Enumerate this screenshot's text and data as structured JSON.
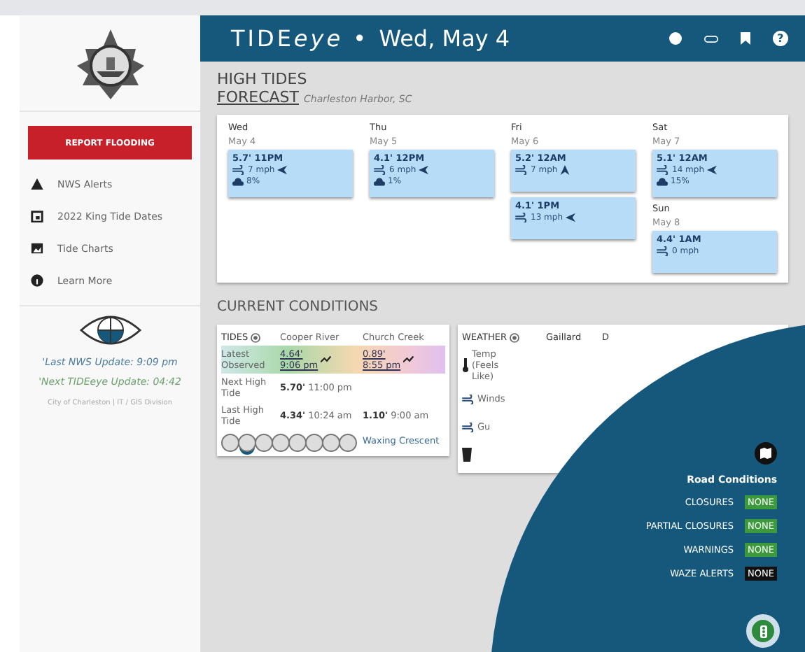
{
  "header": {
    "brand": "TIDE",
    "brand_em": "eye",
    "separator": "•",
    "date": "Wed, May 4",
    "help_icon": "?"
  },
  "sidebar": {
    "report_button": "REPORT FLOODING",
    "links": [
      {
        "label": "NWS Alerts",
        "kind": "alert"
      },
      {
        "label": "2022 King Tide Dates",
        "kind": "calendar"
      },
      {
        "label": "Tide Charts",
        "kind": "chart"
      },
      {
        "label": "Learn More",
        "kind": "info"
      }
    ],
    "last_update": "'Last NWS Update: 9:09 pm",
    "next_update": "'Next TIDEeye Update: 04:42",
    "credit": "City of Charleston | IT / GIS Division"
  },
  "forecast": {
    "title": "HIGH TIDES",
    "subtitle": "FORECAST",
    "location": "Charleston Harbor, SC",
    "columns": [
      {
        "days": [
          {
            "day": "Wed",
            "date": "May 4",
            "tides": [
              {
                "height": "5.7'",
                "time": "11PM",
                "wind": "7 mph",
                "kind": "left",
                "precip": "8%"
              }
            ]
          }
        ]
      },
      {
        "days": [
          {
            "day": "Thu",
            "date": "May 5",
            "tides": [
              {
                "height": "4.1'",
                "time": "12PM",
                "wind": "6 mph",
                "kind": "left",
                "precip": "1%"
              }
            ]
          }
        ]
      },
      {
        "days": [
          {
            "day": "Fri",
            "date": "May 6",
            "tides": [
              {
                "height": "5.2'",
                "time": "12AM",
                "wind": "7 mph",
                "kind": "up"
              },
              {
                "height": "4.1'",
                "time": "1PM",
                "wind": "13 mph",
                "kind": "left"
              }
            ]
          }
        ]
      },
      {
        "days": [
          {
            "day": "Sat",
            "date": "May 7",
            "tides": [
              {
                "height": "5.1'",
                "time": "12AM",
                "wind": "14 mph",
                "kind": "left",
                "precip": "15%"
              }
            ]
          },
          {
            "day": "Sun",
            "date": "May 8",
            "tides": [
              {
                "height": "4.4'",
                "time": "1AM",
                "wind": "0 mph",
                "kind": "calm"
              }
            ]
          }
        ]
      }
    ]
  },
  "conditions": {
    "title": "CURRENT CONDITIONS",
    "tides": {
      "heading": "TIDES",
      "columns": [
        "Cooper River",
        "Church Creek"
      ],
      "rows": [
        {
          "label": "Latest Observed",
          "kind": "observed",
          "cells": [
            {
              "height": "4.64'",
              "time": "9:06 pm"
            },
            {
              "height": "0.89'",
              "time": "8:55 pm"
            }
          ]
        },
        {
          "label": "Next High Tide",
          "kind": "plain",
          "cells": [
            {
              "height": "5.70'",
              "time": "11:00 pm"
            }
          ]
        },
        {
          "label": "Last High Tide",
          "kind": "plain",
          "cells": [
            {
              "height": "4.34'",
              "time": "10:24 am"
            },
            {
              "height": "1.10'",
              "time": "9:00 am"
            }
          ]
        }
      ],
      "moon": {
        "phases": [
          {
            "selected": false
          },
          {
            "selected": true
          },
          {
            "selected": false
          },
          {
            "selected": false
          },
          {
            "selected": false
          },
          {
            "selected": false
          },
          {
            "selected": false
          },
          {
            "selected": false
          }
        ],
        "label": "Waxing Crescent"
      }
    },
    "weather": {
      "heading": "WEATHER",
      "columns": [
        "Gaillard",
        "D"
      ],
      "rows": [
        {
          "label": "Temp (Feels Like)",
          "kind": "temp"
        },
        {
          "label": "Winds",
          "kind": "wind"
        },
        {
          "label": "Gu",
          "kind": "wind"
        },
        {
          "kind": "rain"
        }
      ]
    }
  },
  "road_conditions": {
    "title": "Road Conditions",
    "items": [
      {
        "label": "CLOSURES",
        "status": "NONE",
        "color": "#3c9a3c"
      },
      {
        "label": "PARTIAL CLOSURES",
        "status": "NONE",
        "color": "#3c9a3c"
      },
      {
        "label": "WARNINGS",
        "status": "NONE",
        "color": "#3c9a3c"
      },
      {
        "label": "WAZE ALERTS",
        "status": "NONE",
        "color": "#111111"
      }
    ]
  }
}
